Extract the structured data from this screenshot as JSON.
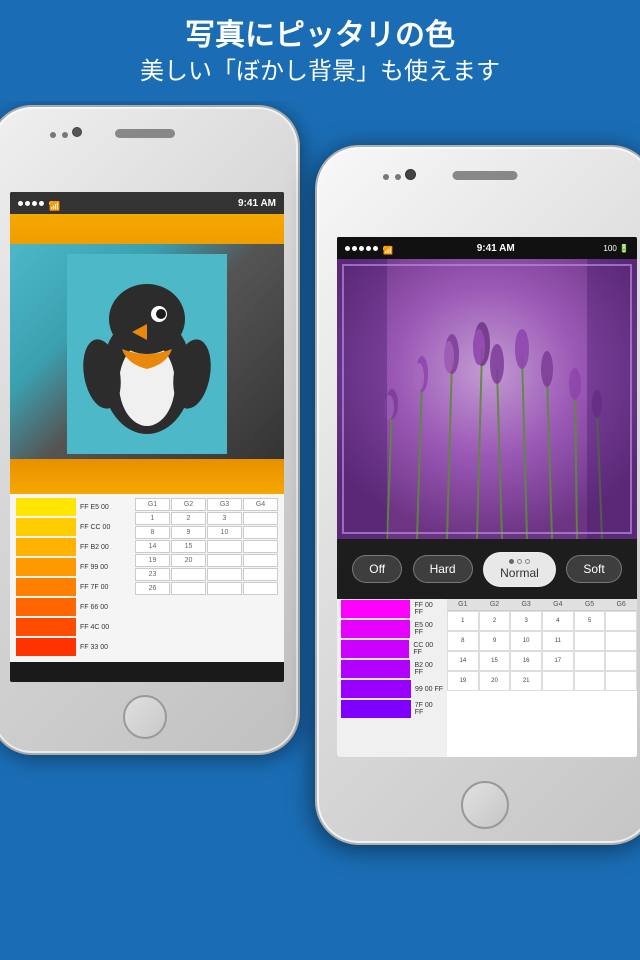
{
  "header": {
    "title": "写真にピッタリの色",
    "subtitle": "美しい「ぼかし背景」も使えます"
  },
  "left_phone": {
    "status": {
      "dots": 4,
      "wifi": "WiFi",
      "time": "9:41 AM"
    },
    "palette_rows": [
      {
        "hex": "FF E5 00",
        "color": "#FFE500"
      },
      {
        "hex": "FF CC 00",
        "color": "#FFCC00"
      },
      {
        "hex": "FF B2 00",
        "color": "#FFB200"
      },
      {
        "hex": "FF 99 00",
        "color": "#FF9900"
      },
      {
        "hex": "FF 7F 00",
        "color": "#FF7F00"
      },
      {
        "hex": "FF 66 00",
        "color": "#FF6600"
      },
      {
        "hex": "FF 4C 00",
        "color": "#FF4C00"
      },
      {
        "hex": "FF 33 00",
        "color": "#FF3300"
      }
    ],
    "grid_headers": [
      "G1",
      "G2",
      "G3",
      "G4"
    ],
    "grid_cells": [
      [
        {
          "val": "1"
        },
        {
          "val": "2"
        },
        {
          "val": "3"
        },
        {
          "val": ""
        }
      ],
      [
        {
          "val": "8"
        },
        {
          "val": "9"
        },
        {
          "val": "10"
        },
        {
          "val": ""
        }
      ],
      [
        {
          "val": "14"
        },
        {
          "val": "15"
        },
        {
          "val": ""
        },
        {
          "val": ""
        }
      ],
      [
        {
          "val": "19"
        },
        {
          "val": "20"
        },
        {
          "val": ""
        },
        {
          "val": ""
        }
      ],
      [
        {
          "val": "23"
        },
        {
          "val": ""
        },
        {
          "val": ""
        },
        {
          "val": ""
        }
      ],
      [
        {
          "val": "26"
        },
        {
          "val": ""
        },
        {
          "val": ""
        },
        {
          "val": ""
        }
      ]
    ]
  },
  "right_phone": {
    "status": {
      "dots": 5,
      "wifi": "WiFi",
      "time": "9:41 AM",
      "battery": "100"
    },
    "blur_buttons": [
      {
        "label": "Off",
        "active": false
      },
      {
        "label": "Hard",
        "active": false
      },
      {
        "label": "Normal",
        "active": true
      },
      {
        "label": "Soft",
        "active": false
      }
    ],
    "palette_rows": [
      {
        "hex": "FF 00 FF",
        "color": "#FF00FF"
      },
      {
        "hex": "E5 00 FF",
        "color": "#E500FF"
      },
      {
        "hex": "CC 00 FF",
        "color": "#CC00FF"
      },
      {
        "hex": "B2 00 FF",
        "color": "#B200FF"
      },
      {
        "hex": "99 00 FF",
        "color": "#9900FF"
      },
      {
        "hex": "7F 00 FF",
        "color": "#7F00FF"
      }
    ],
    "grid_headers": [
      "G1",
      "G2",
      "G3",
      "G4",
      "G5",
      "G6"
    ],
    "grid_data": [
      [
        {
          "val": "1"
        },
        {
          "val": "2"
        },
        {
          "val": "3"
        },
        {
          "val": "4"
        },
        {
          "val": "5"
        },
        {
          "val": ""
        }
      ],
      [
        {
          "val": "8"
        },
        {
          "val": "9"
        },
        {
          "val": "10"
        },
        {
          "val": "11"
        },
        {
          "val": ""
        },
        {
          "val": ""
        }
      ],
      [
        {
          "val": "14"
        },
        {
          "val": "15"
        },
        {
          "val": "16"
        },
        {
          "val": "17"
        },
        {
          "val": ""
        },
        {
          "val": ""
        }
      ],
      [
        {
          "val": "19"
        },
        {
          "val": "20"
        },
        {
          "val": "21"
        },
        {
          "val": ""
        },
        {
          "val": ""
        },
        {
          "val": ""
        }
      ]
    ]
  }
}
